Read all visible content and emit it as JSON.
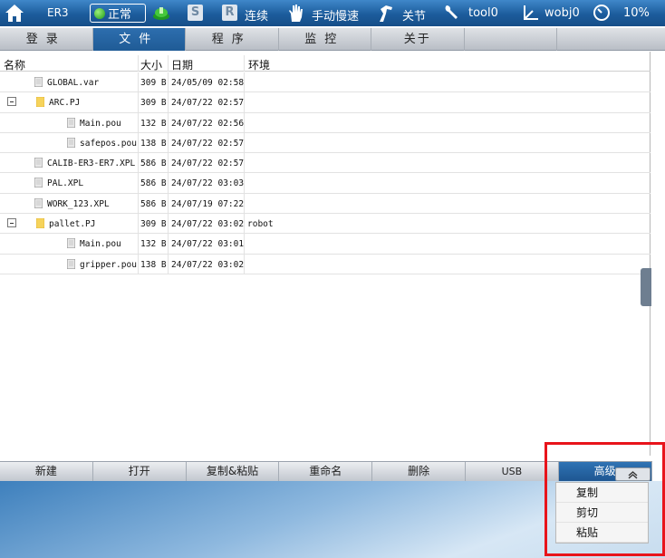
{
  "topbar": {
    "robot_name": "ER3",
    "status": "正常",
    "key_s": "S",
    "key_r": "R",
    "run_mode": "连续",
    "speed_mode": "手动慢速",
    "coord": "关节",
    "tool": "tool0",
    "wobj": "wobj0",
    "speed_percent": "10%",
    "icons": [
      "home-icon",
      "status-dot-icon",
      "power-icon",
      "hand-icon",
      "joint-icon",
      "wrench-icon",
      "axis-icon",
      "speedometer-icon"
    ]
  },
  "menu": {
    "tabs": [
      "登录",
      "文件",
      "程序",
      "监控",
      "关于",
      ""
    ],
    "active": "文件"
  },
  "table": {
    "headers": {
      "name": "名称",
      "size": "大小",
      "date": "日期",
      "env": "环境"
    },
    "rows": [
      {
        "name": "GLOBAL.var",
        "size": "309 B",
        "date": "24/05/09 02:58",
        "env": "",
        "type": "file",
        "level": 0
      },
      {
        "name": "ARC.PJ",
        "size": "309 B",
        "date": "24/07/22 02:57",
        "env": "",
        "type": "folder",
        "level": 0,
        "expanded": true
      },
      {
        "name": "Main.pou",
        "size": "132 B",
        "date": "24/07/22 02:56",
        "env": "",
        "type": "file",
        "level": 1
      },
      {
        "name": "safepos.pou",
        "size": "138 B",
        "date": "24/07/22 02:57",
        "env": "",
        "type": "file",
        "level": 1
      },
      {
        "name": "CALIB-ER3-ER7.XPL",
        "size": "586 B",
        "date": "24/07/22 02:57",
        "env": "",
        "type": "file",
        "level": 0
      },
      {
        "name": "PAL.XPL",
        "size": "586 B",
        "date": "24/07/22 03:03",
        "env": "",
        "type": "file",
        "level": 0
      },
      {
        "name": "WORK_123.XPL",
        "size": "586 B",
        "date": "24/07/19 07:22",
        "env": "",
        "type": "file",
        "level": 0
      },
      {
        "name": "pallet.PJ",
        "size": "309 B",
        "date": "24/07/22 03:02",
        "env": "robot",
        "type": "folder",
        "level": 0,
        "expanded": true
      },
      {
        "name": "Main.pou",
        "size": "132 B",
        "date": "24/07/22 03:01",
        "env": "",
        "type": "file",
        "level": 1
      },
      {
        "name": "gripper.pou",
        "size": "138 B",
        "date": "24/07/22 03:02",
        "env": "",
        "type": "file",
        "level": 1
      }
    ]
  },
  "toolbar": {
    "buttons": [
      "新建",
      "打开",
      "复制&粘贴",
      "重命名",
      "删除",
      "USB",
      "高级"
    ]
  },
  "popup": {
    "items": [
      "复制",
      "剪切",
      "粘贴"
    ]
  },
  "colors": {
    "accent_blue": "#1f5b96",
    "highlight_red": "#e8141b"
  }
}
